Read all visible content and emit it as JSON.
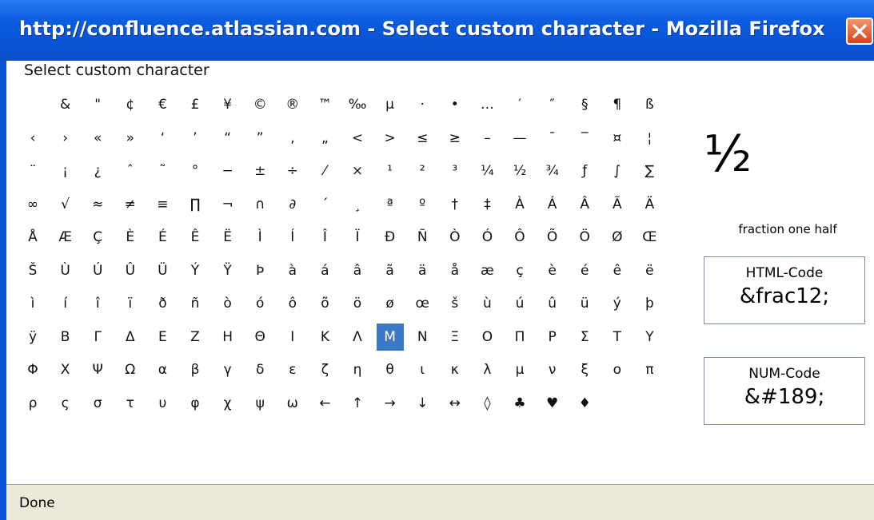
{
  "window": {
    "title": "http://confluence.atlassian.com - Select custom character - Mozilla Firefox"
  },
  "dialog": {
    "caption": "Select custom character"
  },
  "grid": {
    "rows": [
      [
        "&",
        "\"",
        "¢",
        "€",
        "£",
        "¥",
        "©",
        "®",
        "™",
        "‰",
        "µ",
        "·",
        "•",
        "…",
        "′",
        "″",
        "§",
        "¶",
        "ß"
      ],
      [
        "‹",
        "›",
        "«",
        "»",
        "‘",
        "’",
        "“",
        "”",
        "‚",
        "„",
        "<",
        ">",
        "≤",
        "≥",
        "–",
        "—",
        "¯",
        "‾",
        "¤",
        "¦"
      ],
      [
        "¨",
        "¡",
        "¿",
        "ˆ",
        "˜",
        "°",
        "−",
        "±",
        "÷",
        "⁄",
        "×",
        "¹",
        "²",
        "³",
        "¼",
        "½",
        "¾",
        "ƒ",
        "∫",
        "∑"
      ],
      [
        "∞",
        "√",
        "≈",
        "≠",
        "≡",
        "∏",
        "¬",
        "∩",
        "∂",
        "´",
        "¸",
        "ª",
        "º",
        "†",
        "‡",
        "À",
        "Á",
        "Â",
        "Ã",
        "Ä"
      ],
      [
        "Å",
        "Æ",
        "Ç",
        "È",
        "É",
        "Ê",
        "Ë",
        "Ì",
        "Í",
        "Î",
        "Ï",
        "Đ",
        "Ñ",
        "Ò",
        "Ó",
        "Ô",
        "Õ",
        "Ö",
        "Ø",
        "Œ"
      ],
      [
        "Š",
        "Ù",
        "Ú",
        "Û",
        "Ü",
        "Ý",
        "Ÿ",
        "Þ",
        "à",
        "á",
        "â",
        "ã",
        "ä",
        "å",
        "æ",
        "ç",
        "è",
        "é",
        "ê",
        "ë"
      ],
      [
        "ì",
        "í",
        "î",
        "ï",
        "ð",
        "ñ",
        "ò",
        "ó",
        "ô",
        "õ",
        "ö",
        "ø",
        "œ",
        "š",
        "ù",
        "ú",
        "û",
        "ü",
        "ý",
        "þ"
      ],
      [
        "ÿ",
        "Β",
        "Γ",
        "Δ",
        "Ε",
        "Ζ",
        "Η",
        "Θ",
        "Ι",
        "Κ",
        "Λ",
        "Μ",
        "Ν",
        "Ξ",
        "Ο",
        "Π",
        "Ρ",
        "Σ",
        "Τ",
        "Υ"
      ],
      [
        "Φ",
        "Χ",
        "Ψ",
        "Ω",
        "α",
        "β",
        "γ",
        "δ",
        "ε",
        "ζ",
        "η",
        "θ",
        "ι",
        "κ",
        "λ",
        "μ",
        "ν",
        "ξ",
        "ο",
        "π"
      ],
      [
        "ρ",
        "ς",
        "σ",
        "τ",
        "υ",
        "φ",
        "χ",
        "ψ",
        "ω",
        "←",
        "↑",
        "→",
        "↓",
        "↔",
        "◊",
        "♣",
        "♥",
        "♦"
      ]
    ],
    "selected": {
      "row": 7,
      "col": 11
    }
  },
  "preview": {
    "char": "½",
    "name": "fraction one half",
    "html_label": "HTML-Code",
    "html_value": "&frac12;",
    "num_label": "NUM-Code",
    "num_value": "&#189;"
  },
  "status": {
    "text": "Done"
  }
}
